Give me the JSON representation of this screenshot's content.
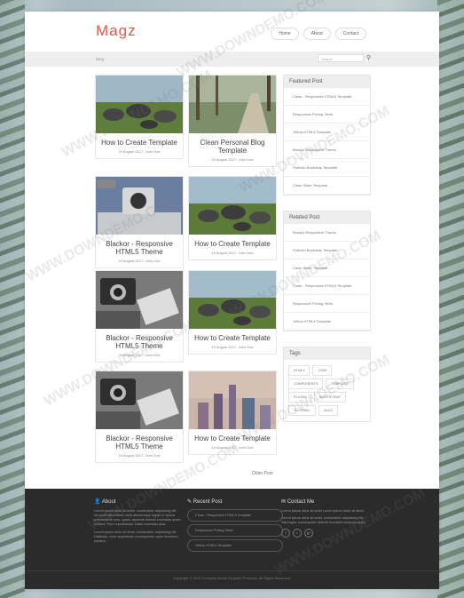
{
  "header": {
    "logo": "Magz",
    "nav": [
      "Home",
      "About",
      "Contact"
    ]
  },
  "breadcrumb": "Blog",
  "search": {
    "placeholder": "Search"
  },
  "posts": [
    {
      "title": "How to Create Template",
      "meta": "19 August 2017, John Doe",
      "image": "stones"
    },
    {
      "title": "Clean Personal Blog Template",
      "meta": "19 August 2017, John Doe",
      "image": "path"
    },
    {
      "title": "Blackor - Responsive HTML5 Theme",
      "meta": "19 August 2017, John Doe",
      "image": "desk"
    },
    {
      "title": "How to Create Template",
      "meta": "19 August 2017, John Doe",
      "image": "stones"
    },
    {
      "title": "Blackor - Responsive HTML5 Theme",
      "meta": "19 August 2017, John Doe",
      "image": "camera"
    },
    {
      "title": "How to Create Template",
      "meta": "19 August 2017, John Doe",
      "image": "stones"
    },
    {
      "title": "Blackor - Responsive HTML5 Theme",
      "meta": "19 August 2017, John Doe",
      "image": "camera"
    },
    {
      "title": "How to Create Template",
      "meta": "19 August 2017, John Doe",
      "image": "city"
    }
  ],
  "older": "Older Post",
  "featured": {
    "title": "Featured Post",
    "items": [
      "Clean - Responsive HTML5 Template",
      "Responsive Pricing Table",
      "Yellow HTML5 Template",
      "Blackor Responsive Theme",
      "Portfolio Bootstrap Template",
      "Clean Slider Template"
    ]
  },
  "related": {
    "title": "Related Post",
    "items": [
      "Blackor Responsive Theme",
      "Portfolio Bootstrap Template",
      "Clean Slider Template",
      "Clean - Responsive HTML5 Template",
      "Responsive Pricing Table",
      "Yellow HTML5 Template"
    ]
  },
  "tags": {
    "title": "Tags",
    "items": [
      "HTML5",
      "CSS3",
      "COMPONENTS",
      "TEMPLATE",
      "PLUGIN",
      "BOOTSTRAP",
      "TUTORIAL",
      "UI/UX"
    ]
  },
  "footer": {
    "about": {
      "title": "About",
      "p1": "Lorem ipsum dolor sit amet, consectetur adipisicing elit. Ab amet laboriosam nulla doloremque fugiat ut, labore praesentium eum, quasi, sapiente deleniti molestias quam minima. Rem repudiandae totam molestias ipsa.",
      "p2": "Lorem ipsum dolor sit amet, consectetur adipisicing elit. Distinctio, error superanda consequuntur quos inventore pariatur."
    },
    "recent": {
      "title": "Recent Post",
      "items": [
        "Clean - Responsive HTML5 Template",
        "Responsive Pricing Table",
        "Yellow HTML5 Template"
      ]
    },
    "contact": {
      "title": "Contact Me",
      "p1": "Lorem ipsum dolor sit amet Lorem ipsum dolor sit amet.",
      "p2": "Lorem ipsum dolor sit amet, consectetur adipisicing elit. Nisi fugiat, consequatur deleniti excepturi tempora sequi.",
      "social": [
        "f",
        "t",
        "g+"
      ]
    },
    "copyright": "Copyright © 2015 Company Name by Ayam Promotia. All Rights Reserved."
  },
  "watermark": "WWW.DOWNDEMO.COM"
}
